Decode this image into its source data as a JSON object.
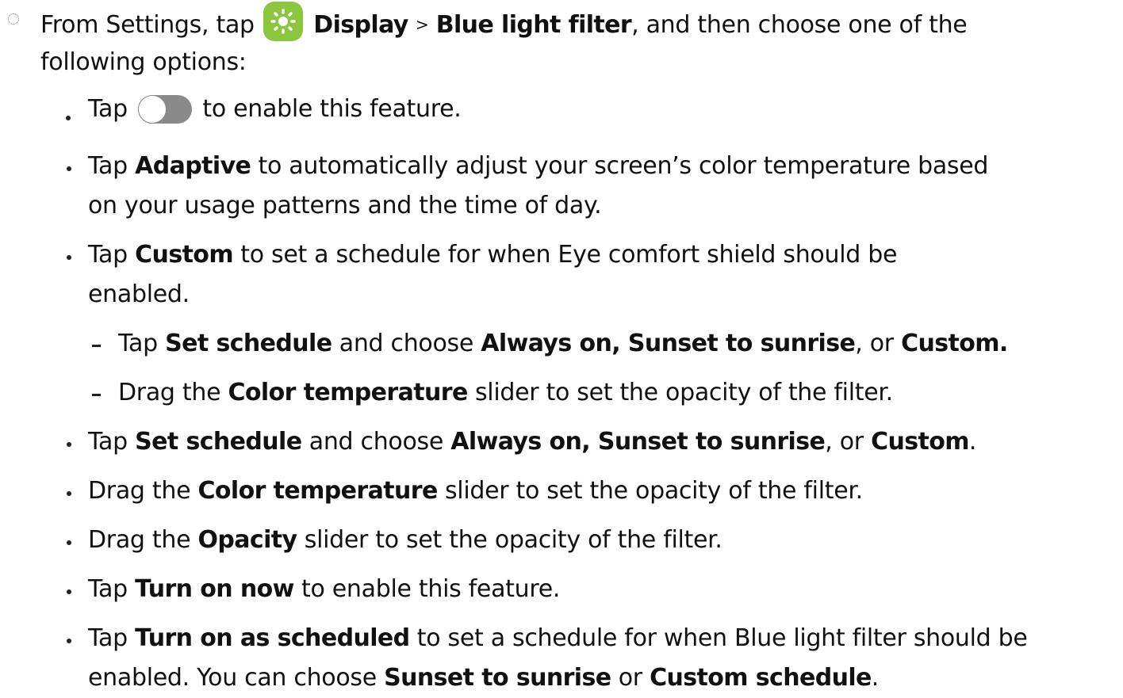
{
  "step": {
    "prefix": "From Settings, tap",
    "icon": "settings-gear-icon",
    "icon_color": "#8cc63f",
    "path_1": "Display",
    "separator": ">",
    "path_2": "Blue light filter",
    "suffix_1": ", and then choose one of the",
    "suffix_2": "following options:"
  },
  "options": [
    {
      "before": "Tap",
      "icon": "toggle-icon",
      "after": "to enable this feature."
    },
    {
      "before": "Tap",
      "bold": "Adaptive",
      "after": "to automatically adjust your screen’s color temperature based",
      "line2": "on your usage patterns and the time of day."
    },
    {
      "before": "Tap",
      "bold": "Custom",
      "after": "to set a schedule for when Eye comfort shield should be",
      "line2": "enabled."
    },
    {
      "before": "Tap",
      "bold": "Set schedule",
      "mid": "and choose",
      "bold_2": "Always on, Sunset to sunrise",
      "mid_2": ", or",
      "bold_3": "Custom",
      "end": "."
    },
    {
      "before": "Drag the",
      "bold": "Color temperature",
      "after": "slider to set the opacity of the filter."
    },
    {
      "before": "Drag the",
      "bold": "Opacity",
      "after": "slider to set the opacity of the filter."
    },
    {
      "before": "Tap",
      "bold": "Turn on now",
      "after": "to enable this feature."
    },
    {
      "before": "Tap",
      "bold": "Turn on as scheduled",
      "after": "to set a schedule for when Blue light filter should be",
      "line2_before": "enabled. You can choose",
      "line2_bold": "Sunset to sunrise",
      "line2_mid": "or",
      "line2_bold_2": "Custom schedule",
      "line2_end": "."
    }
  ],
  "sub_options": [
    {
      "before": "Tap",
      "bold": "Set schedule",
      "mid": "and choose",
      "bold_2": "Always on, Sunset to sunrise",
      "mid_2": ", or",
      "bold_3": "Custom.",
      "end": ""
    },
    {
      "before": "Drag the",
      "bold": "Color temperature",
      "after": "slider to set the opacity of the filter."
    }
  ]
}
